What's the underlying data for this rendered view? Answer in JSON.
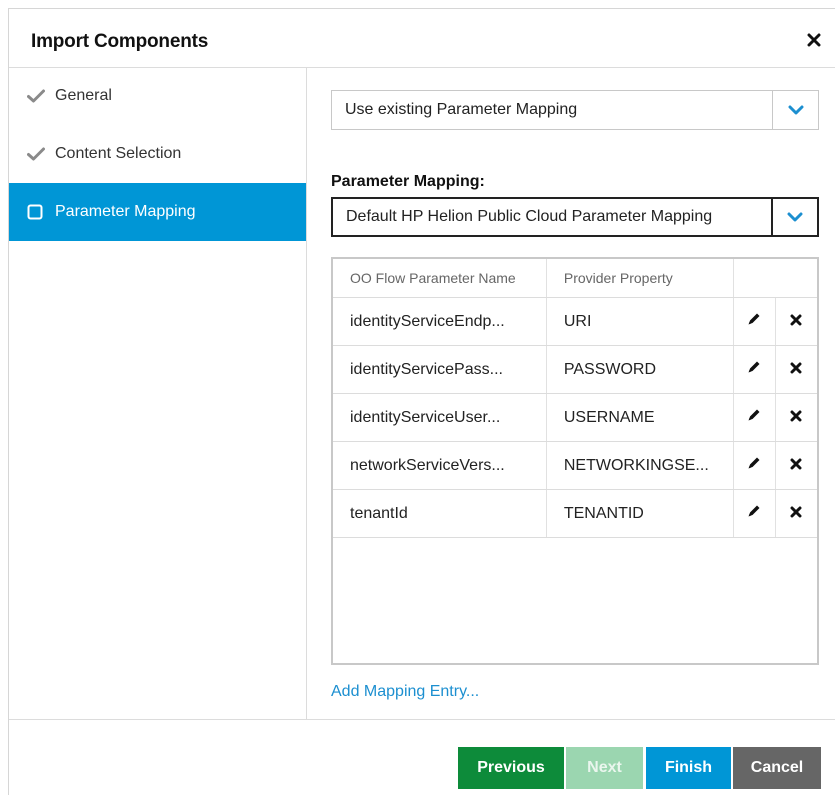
{
  "dialog": {
    "title": "Import Components",
    "close_icon": "close-icon"
  },
  "sidebar": {
    "items": [
      {
        "label": "General",
        "state": "done",
        "icon": "checkmark-icon"
      },
      {
        "label": "Content Selection",
        "state": "done",
        "icon": "checkmark-icon"
      },
      {
        "label": "Parameter Mapping",
        "state": "active",
        "icon": "checkbox-icon"
      }
    ]
  },
  "main": {
    "mapping_mode": {
      "value": "Use existing Parameter Mapping"
    },
    "parameter_mapping": {
      "label": "Parameter Mapping:",
      "value": "Default HP Helion Public Cloud Parameter Mapping"
    },
    "table": {
      "columns": [
        "OO Flow Parameter Name",
        "Provider Property"
      ],
      "rows": [
        {
          "name": "identityServiceEndp...",
          "property": "URI"
        },
        {
          "name": "identityServicePass...",
          "property": "PASSWORD"
        },
        {
          "name": "identityServiceUser...",
          "property": "USERNAME"
        },
        {
          "name": "networkServiceVers...",
          "property": "NETWORKINGSE..."
        },
        {
          "name": "tenantId",
          "property": "TENANTID"
        }
      ]
    },
    "add_link": "Add Mapping Entry..."
  },
  "footer": {
    "previous": "Previous",
    "next": "Next",
    "finish": "Finish",
    "cancel": "Cancel"
  },
  "colors": {
    "accent": "#0096d6",
    "previous": "#0d8b3a",
    "next_disabled": "#9bd6b0",
    "cancel": "#666666",
    "link": "#1c8fd0"
  }
}
